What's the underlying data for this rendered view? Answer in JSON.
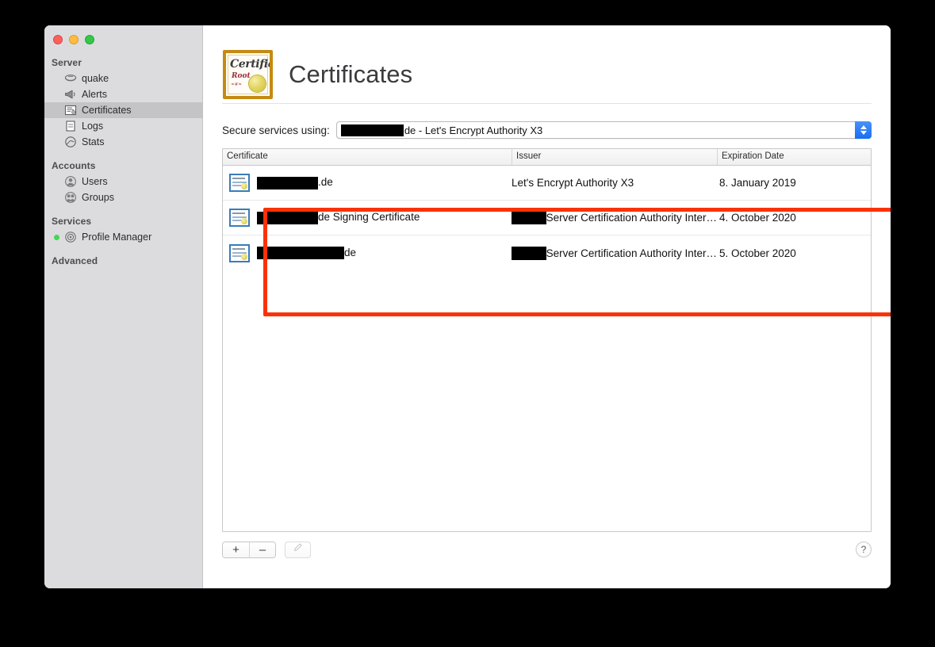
{
  "window": {
    "traffic_lights": [
      "close",
      "minimize",
      "zoom"
    ],
    "colors": {
      "close": "#fc605c",
      "minimize": "#fdbc40",
      "zoom": "#34c749",
      "accent": "#176ef4",
      "highlight": "#fa3207",
      "status_running": "#44d655"
    }
  },
  "sidebar": {
    "groups": [
      {
        "title": "Server",
        "items": [
          {
            "label": "quake",
            "icon": "server-icon",
            "selected": false
          },
          {
            "label": "Alerts",
            "icon": "megaphone-icon",
            "selected": false
          },
          {
            "label": "Certificates",
            "icon": "certificate-icon",
            "selected": true
          },
          {
            "label": "Logs",
            "icon": "document-icon",
            "selected": false
          },
          {
            "label": "Stats",
            "icon": "stats-icon",
            "selected": false
          }
        ]
      },
      {
        "title": "Accounts",
        "items": [
          {
            "label": "Users",
            "icon": "user-icon",
            "selected": false
          },
          {
            "label": "Groups",
            "icon": "group-icon",
            "selected": false
          }
        ]
      },
      {
        "title": "Services",
        "items": [
          {
            "label": "Profile Manager",
            "icon": "gear-icon",
            "selected": false,
            "status": "running"
          }
        ]
      },
      {
        "title": "Advanced",
        "items": []
      }
    ]
  },
  "header": {
    "title": "Certificates",
    "icon": "certificate-root-icon",
    "icon_text": {
      "line1": "Certificate",
      "line2": "Root",
      "line3": "❧❦❧"
    }
  },
  "secure_services": {
    "label": "Secure services using:",
    "selected_value": "de - Let's Encrypt Authority X3",
    "redacted_prefix": true
  },
  "table": {
    "columns": [
      "Certificate",
      "Issuer",
      "Expiration Date"
    ],
    "rows": [
      {
        "certificate": ".de",
        "certificate_redacted": "medium",
        "issuer": "Let's Encrypt Authority X3",
        "issuer_redacted": false,
        "expiration": "8. January 2019"
      },
      {
        "certificate": "de Signing Certificate",
        "certificate_redacted": "medium",
        "issuer": "Server Certification Authority Inter…",
        "issuer_redacted": true,
        "expiration": "4. October 2020"
      },
      {
        "certificate": "de",
        "certificate_redacted": "large",
        "issuer": "Server Certification Authority Inter…",
        "issuer_redacted": true,
        "expiration": "5. October 2020"
      }
    ]
  },
  "footer": {
    "add_label": "+",
    "remove_label": "–",
    "edit_icon": "pencil-icon",
    "help_label": "?"
  }
}
